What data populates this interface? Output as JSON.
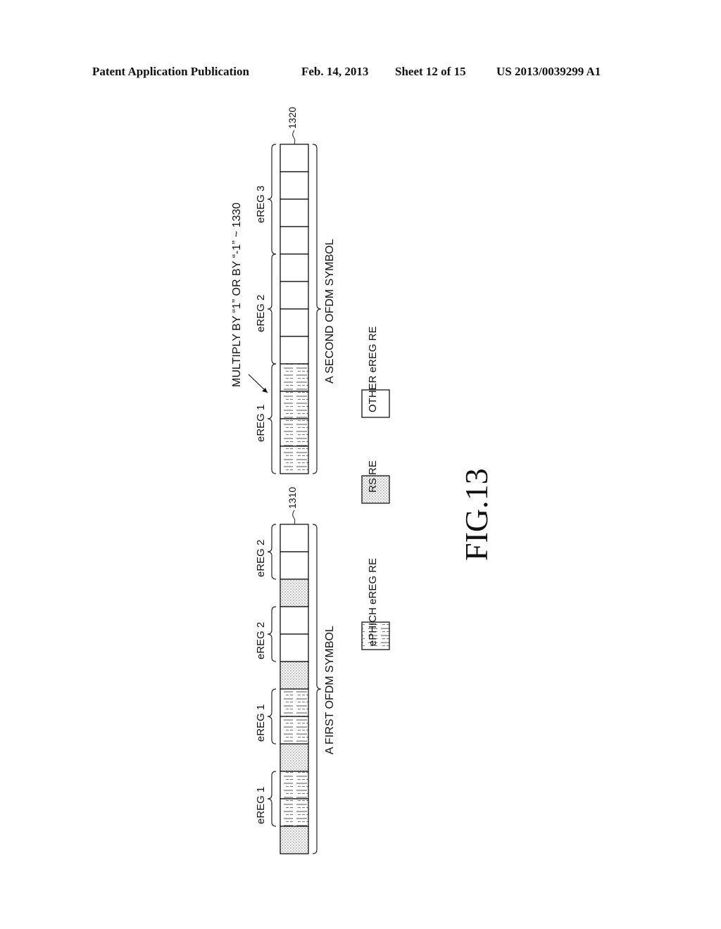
{
  "header": {
    "left": "Patent Application Publication",
    "date": "Feb. 14, 2013",
    "sheet": "Sheet 12 of 15",
    "number": "US 2013/0039299 A1"
  },
  "figure": {
    "label": "FIG.13",
    "annotation": "MULTIPLY BY “1” OR BY “-1”",
    "annotation_ref": "1330",
    "symbols": [
      {
        "ref": "1320",
        "caption": "A SECOND OFDM SYMBOL",
        "cells_top_to_bottom": [
          "other",
          "other",
          "other",
          "other",
          "other",
          "other",
          "other",
          "other",
          "ephich",
          "ephich",
          "ephich",
          "ephich"
        ],
        "groups": [
          {
            "label": "eREG 3",
            "start": 0,
            "count": 4
          },
          {
            "label": "eREG 2",
            "start": 4,
            "count": 4
          },
          {
            "label": "eREG 1",
            "start": 8,
            "count": 4
          }
        ]
      },
      {
        "ref": "1310",
        "caption": "A FIRST OFDM SYMBOL",
        "cells_top_to_bottom": [
          "other",
          "other",
          "rs",
          "other",
          "other",
          "rs",
          "ephich",
          "ephich",
          "rs",
          "ephich",
          "ephich",
          "rs"
        ],
        "groups": [
          {
            "label": "eREG 2",
            "start": 0,
            "count": 2
          },
          {
            "label": "eREG 2",
            "start": 3,
            "count": 2
          },
          {
            "label": "eREG 1",
            "start": 6,
            "count": 2
          },
          {
            "label": "eREG 1",
            "start": 9,
            "count": 2
          }
        ]
      }
    ],
    "legend": [
      {
        "type": "ephich",
        "label": "ePHICH eREG RE"
      },
      {
        "type": "rs",
        "label": "RS RE"
      },
      {
        "type": "other",
        "label": "OTHER eREG RE"
      }
    ]
  }
}
